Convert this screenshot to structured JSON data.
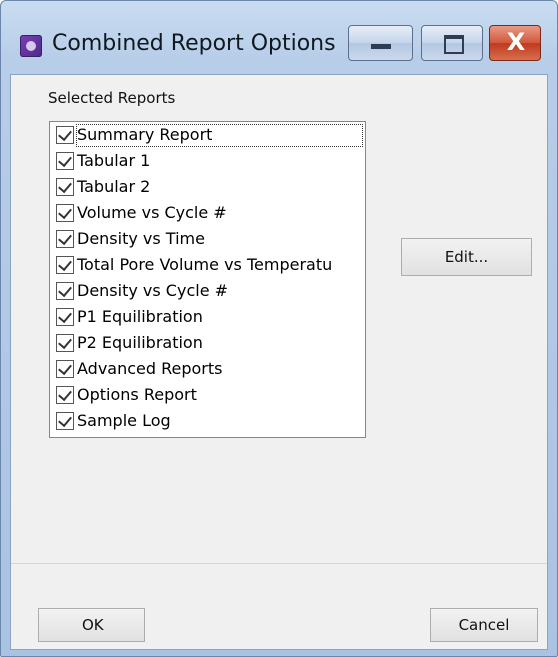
{
  "window": {
    "title": "Combined Report Options",
    "close_glyph": "X"
  },
  "section": {
    "label": "Selected Reports"
  },
  "reports": [
    {
      "label": "Summary Report",
      "checked": true
    },
    {
      "label": "Tabular 1",
      "checked": true
    },
    {
      "label": "Tabular 2",
      "checked": true
    },
    {
      "label": "Volume vs Cycle #",
      "checked": true
    },
    {
      "label": "Density vs Time",
      "checked": true
    },
    {
      "label": "Total Pore Volume vs Temperatu",
      "checked": true
    },
    {
      "label": "Density vs Cycle #",
      "checked": true
    },
    {
      "label": "P1 Equilibration",
      "checked": true
    },
    {
      "label": "P2 Equilibration",
      "checked": true
    },
    {
      "label": "Advanced Reports",
      "checked": true
    },
    {
      "label": "Options Report",
      "checked": true
    },
    {
      "label": "Sample Log",
      "checked": true
    }
  ],
  "buttons": {
    "edit": "Edit...",
    "ok": "OK",
    "cancel": "Cancel"
  },
  "icons": {
    "app": "app-icon",
    "minimize": "minimize-icon",
    "maximize": "maximize-icon",
    "close": "close-icon"
  }
}
